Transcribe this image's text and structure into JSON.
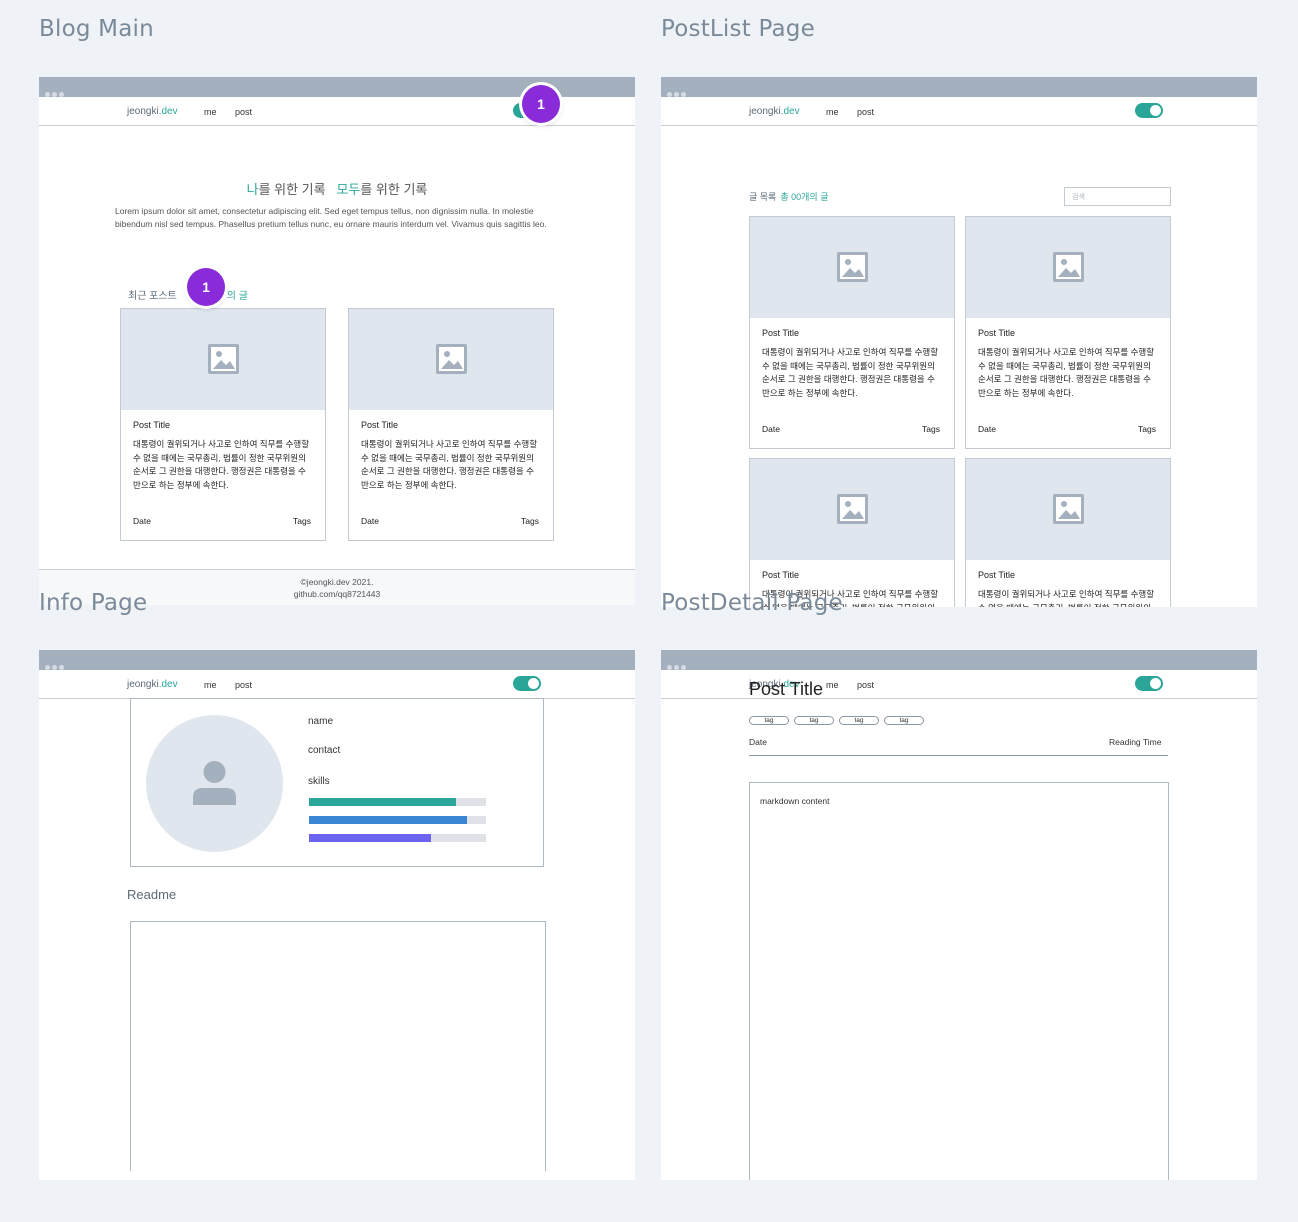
{
  "frames": {
    "blog_main": "Blog Main",
    "post_list": "PostList Page",
    "info": "Info Page",
    "post_detail": "PostDetail Page"
  },
  "nav": {
    "brand_main": "jeongki",
    "brand_suffix": ".dev",
    "me": "me",
    "post": "post"
  },
  "badge": "1",
  "hero": {
    "part1_accent": "나",
    "part1_rest": "를 위한 기록",
    "part2_accent": "모두",
    "part2_rest": "를 위한 기록",
    "lorem": "Lorem ipsum dolor sit amet, consectetur adipiscing elit. Sed eget tempus tellus, non dignissim nulla. In molestie bibendum nisl sed tempus. Phasellus pretium tellus nunc, eu ornare mauris interdum vel. Vivamus quis sagittis leo."
  },
  "recent": {
    "label": "최근 포스트",
    "accent": "의 글"
  },
  "card": {
    "title": "Post Title",
    "body": "대통령이 궐위되거나 사고로 인하여 직무를 수행할 수 없을 때에는 국무총리, 법률이 정한 국무위원의 순서로 그 권한을 대행한다. 행정권은 대통령을 수반으로 하는 정부에 속한다.",
    "date": "Date",
    "tags": "Tags"
  },
  "footer": {
    "copyright": "©jeongki.dev 2021.",
    "github": "github.com/qq8721443"
  },
  "post_list": {
    "heading": "글 목록",
    "count": "총 00개의 글",
    "search_placeholder": "검색"
  },
  "info": {
    "name": "name",
    "contact": "contact",
    "skills": "skills",
    "skill_levels": [
      0.83,
      0.89,
      0.69
    ],
    "skill_colors": [
      "#2aa698",
      "#3a86d4",
      "#6c63ee"
    ],
    "readme": "Readme"
  },
  "detail": {
    "title": "Post Title",
    "tags": [
      "tag",
      "tag",
      "tag",
      "tag"
    ],
    "date": "Date",
    "reading_time": "Reading Time",
    "content": "markdown content"
  }
}
